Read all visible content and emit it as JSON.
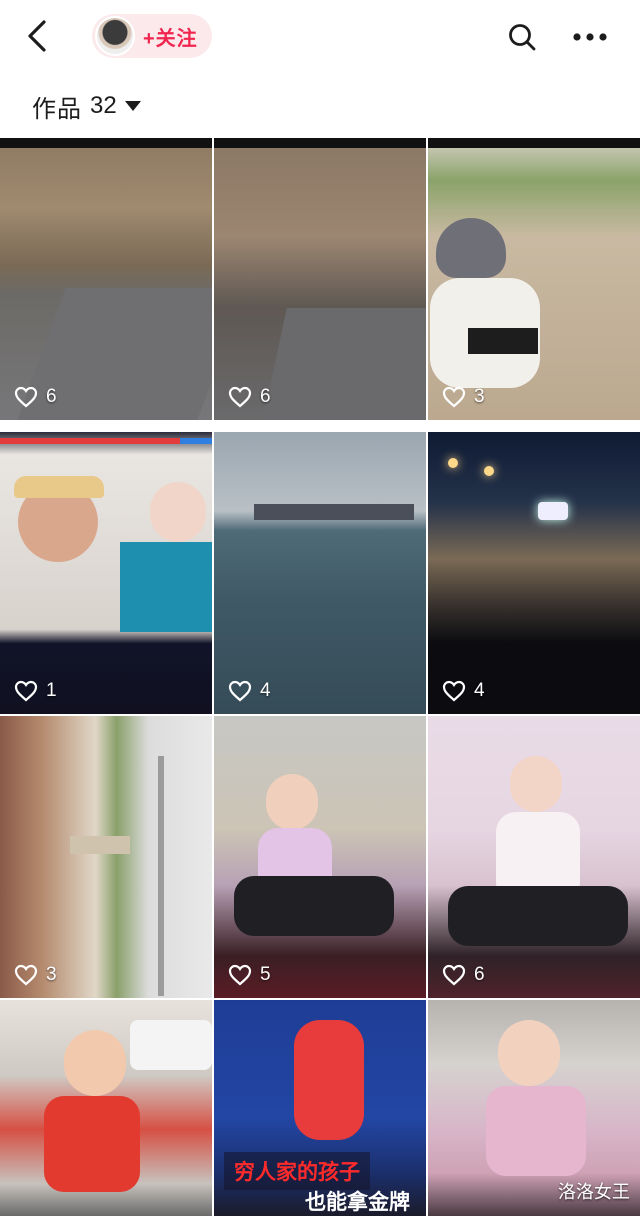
{
  "topbar": {
    "follow_label": "+关注"
  },
  "works": {
    "title": "作品",
    "count": "32"
  },
  "grid": {
    "items": [
      {
        "likes": "6"
      },
      {
        "likes": "6"
      },
      {
        "likes": "3"
      },
      {
        "likes": "1"
      },
      {
        "likes": "4"
      },
      {
        "likes": "4"
      },
      {
        "likes": "3"
      },
      {
        "likes": "5"
      },
      {
        "likes": "6"
      },
      {
        "likes": ""
      },
      {
        "likes": ""
      },
      {
        "likes": ""
      }
    ],
    "overlay_line1": "穷人家的孩子",
    "overlay_line2": "也能拿金牌",
    "watermark": "洛洛女王"
  },
  "icons": {
    "back": "back-arrow-icon",
    "search": "search-icon",
    "more": "more-dots-icon",
    "like": "heart-icon",
    "dropdown": "caret-down-icon"
  },
  "colors": {
    "accent": "#f0264f",
    "pill_bg": "#fbe9ec"
  }
}
